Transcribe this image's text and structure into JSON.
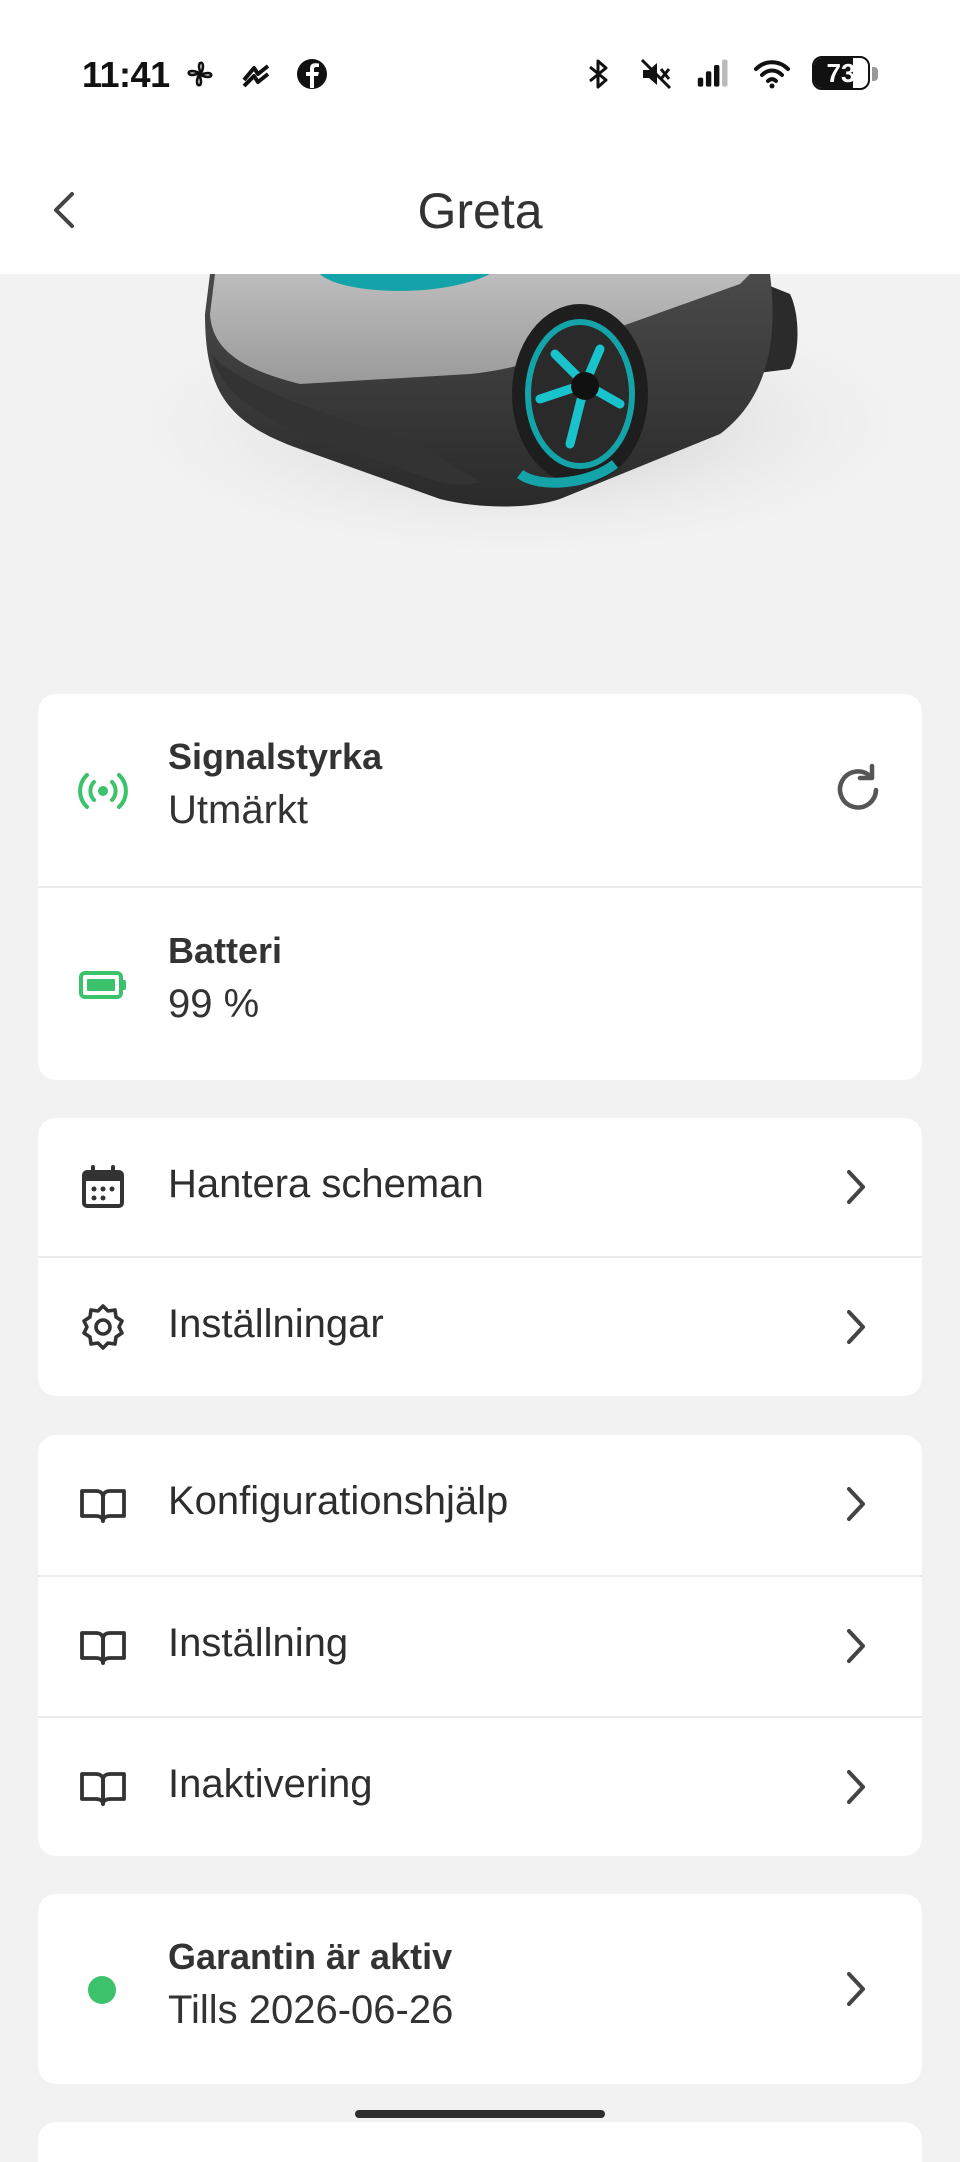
{
  "status_bar": {
    "time": "11:41",
    "left_icons": [
      "fan-icon",
      "messenger-icon",
      "facebook-icon"
    ],
    "right_icons": [
      "bluetooth-icon",
      "mute-icon",
      "signal-icon",
      "wifi-icon"
    ],
    "battery_level": "73"
  },
  "nav": {
    "title": "Greta",
    "back_icon": "chevron-left-icon"
  },
  "status_card": {
    "signal": {
      "title": "Signalstyrka",
      "value": "Utmärkt",
      "icon": "signal-strength-icon",
      "icon_color": "#3cc26a",
      "action_icon": "refresh-icon"
    },
    "battery": {
      "title": "Batteri",
      "value": "99 %",
      "icon": "battery-icon",
      "icon_color": "#3cc26a"
    }
  },
  "menu_card": {
    "items": [
      {
        "label": "Hantera scheman",
        "icon": "calendar-icon"
      },
      {
        "label": "Inställningar",
        "icon": "gear-icon"
      }
    ]
  },
  "guides_card": {
    "items": [
      {
        "label": "Konfigurationshjälp",
        "icon": "book-icon"
      },
      {
        "label": "Inställning",
        "icon": "book-icon"
      },
      {
        "label": "Inaktivering",
        "icon": "book-icon"
      }
    ]
  },
  "warranty_card": {
    "title": "Garantin är aktiv",
    "value": "Tills 2026-06-26",
    "status_color": "#3cc26a"
  }
}
